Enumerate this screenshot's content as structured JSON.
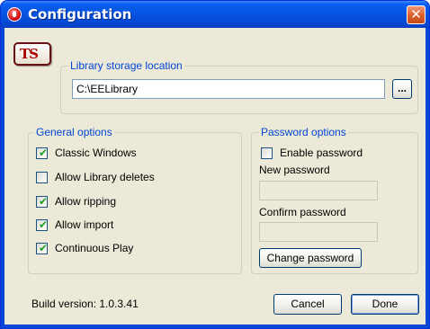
{
  "window": {
    "title": "Configuration",
    "close_label": "✕"
  },
  "logo": {
    "text": "TS"
  },
  "library": {
    "legend": "Library storage location",
    "path_value": "C:\\EELibrary",
    "browse_label": "..."
  },
  "general": {
    "legend": "General options",
    "items": [
      {
        "label": "Classic Windows",
        "checked": true
      },
      {
        "label": "Allow Library deletes",
        "checked": false
      },
      {
        "label": "Allow ripping",
        "checked": true
      },
      {
        "label": "Allow import",
        "checked": true
      },
      {
        "label": "Continuous Play",
        "checked": true
      }
    ]
  },
  "password": {
    "legend": "Password options",
    "enable_label": "Enable password",
    "enable_checked": false,
    "new_label": "New password",
    "new_value": "",
    "confirm_label": "Confirm password",
    "confirm_value": "",
    "change_button": "Change password"
  },
  "footer": {
    "build": "Build version: 1.0.3.41",
    "cancel": "Cancel",
    "done": "Done"
  },
  "check_glyph": "✔"
}
